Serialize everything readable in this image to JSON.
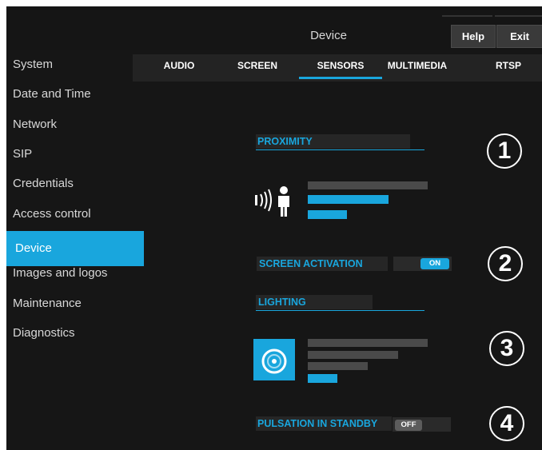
{
  "header": {
    "title": "Device",
    "help_label": "Help",
    "exit_label": "Exit"
  },
  "sidebar": {
    "items": [
      {
        "label": "System"
      },
      {
        "label": "Date and Time"
      },
      {
        "label": "Network"
      },
      {
        "label": "SIP"
      },
      {
        "label": "Credentials"
      },
      {
        "label": "Access control"
      },
      {
        "label": "Device",
        "active": true
      },
      {
        "label": "Images and logos"
      },
      {
        "label": "Maintenance"
      },
      {
        "label": "Diagnostics"
      }
    ]
  },
  "tabs": [
    {
      "label": "AUDIO"
    },
    {
      "label": "SCREEN"
    },
    {
      "label": "SENSORS",
      "active": true
    },
    {
      "label": "MULTIMEDIA"
    },
    {
      "label": "RTSP"
    }
  ],
  "sections": {
    "proximity": {
      "label": "PROXIMITY",
      "number": "1",
      "icon": "proximity-sensor-icon"
    },
    "screen_activation": {
      "label": "SCREEN ACTIVATION",
      "number": "2",
      "toggle": "ON"
    },
    "lighting": {
      "label": "LIGHTING",
      "number": "3",
      "icon": "light-sensor-icon"
    },
    "pulsation": {
      "label": "PULSATION IN STANDBY",
      "number": "4",
      "toggle": "OFF"
    }
  },
  "colors": {
    "accent": "#19a6dd",
    "background": "#161616",
    "button": "#3a3a3a"
  }
}
